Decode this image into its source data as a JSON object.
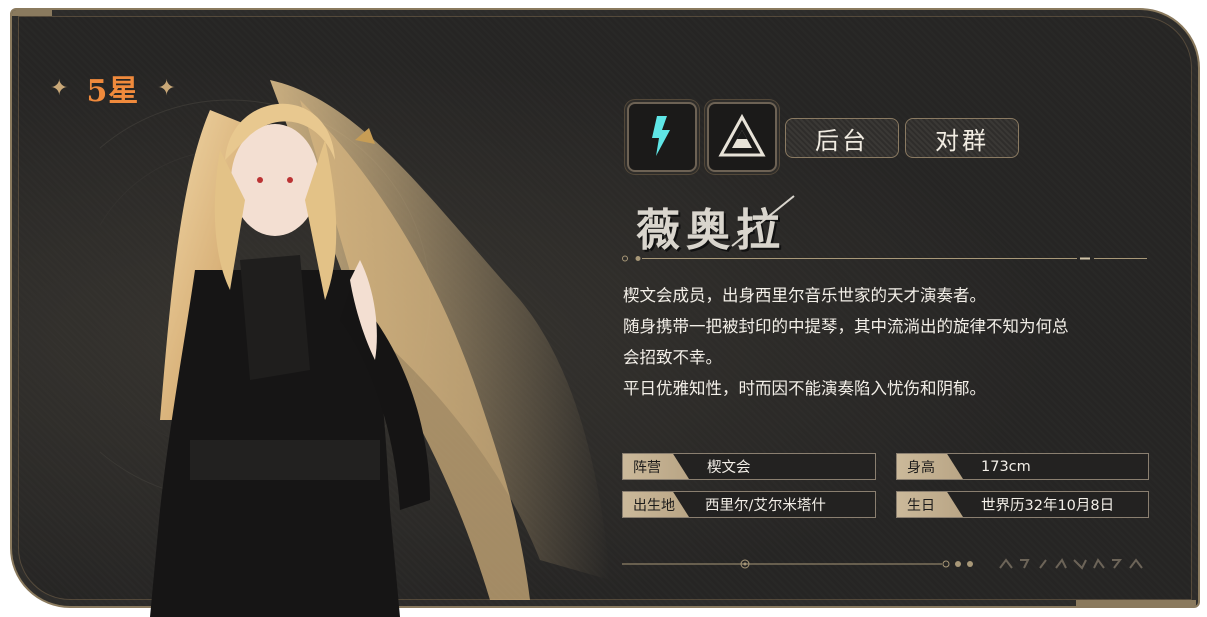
{
  "rarity": {
    "label": "5星",
    "star_icon": "four-point-star-icon"
  },
  "element_icon": {
    "name": "lightning-element-icon",
    "color": "#5fe6e6"
  },
  "class_icon": {
    "name": "triangle-class-icon"
  },
  "tags": [
    "后台",
    "对群"
  ],
  "character": {
    "name": "薇奥拉"
  },
  "description": [
    "楔文会成员，出身西里尔音乐世家的天才演奏者。",
    "随身携带一把被封印的中提琴，其中流淌出的旋律不知为何总",
    "会招致不幸。",
    "平日优雅知性，时而因不能演奏陷入忧伤和阴郁。"
  ],
  "info": {
    "faction": {
      "label": "阵营",
      "value": "楔文会"
    },
    "height": {
      "label": "身高",
      "value": "173cm"
    },
    "birthplace": {
      "label": "出生地",
      "value": "西里尔/艾尔米塔什"
    },
    "birthday": {
      "label": "生日",
      "value": "世界历32年10月8日"
    }
  },
  "colors": {
    "card_bg": "#262524",
    "frame": "#8a7a5e",
    "rarity_text": "#f08a3c",
    "label_bg": "#cbb99a"
  }
}
